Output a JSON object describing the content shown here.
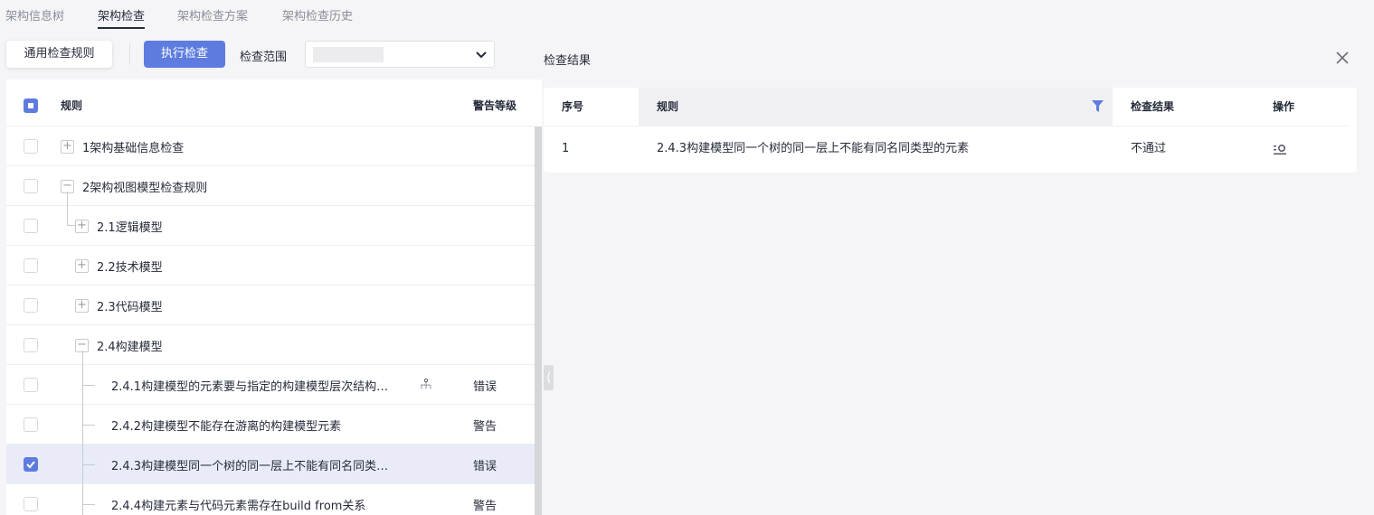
{
  "tabs": [
    "架构信息树",
    "架构检查",
    "架构检查方案",
    "架构检查历史"
  ],
  "toolbar": {
    "general_rules": "通用检查规则",
    "run_check": "执行检查",
    "scope_label": "检查范围",
    "scope_value": ""
  },
  "tree": {
    "header_rule": "规则",
    "header_level": "警告等级",
    "rows": [
      {
        "label": "1架构基础信息检查",
        "level": ""
      },
      {
        "label": "2架构视图模型检查规则",
        "level": ""
      },
      {
        "label": "2.1逻辑模型",
        "level": ""
      },
      {
        "label": "2.2技术模型",
        "level": ""
      },
      {
        "label": "2.3代码模型",
        "level": ""
      },
      {
        "label": "2.4构建模型",
        "level": ""
      },
      {
        "label": "2.4.1构建模型的元素要与指定的构建模型层次结构…",
        "level": "错误"
      },
      {
        "label": "2.4.2构建模型不能存在游离的构建模型元素",
        "level": "警告"
      },
      {
        "label": "2.4.3构建模型同一个树的同一层上不能有同名同类…",
        "level": "错误"
      },
      {
        "label": "2.4.4构建元素与代码元素需存在build from关系",
        "level": "警告"
      }
    ]
  },
  "results": {
    "title": "检查结果",
    "headers": [
      "序号",
      "规则",
      "检查结果",
      "操作"
    ],
    "rows": [
      {
        "index": "1",
        "rule": "2.4.3构建模型同一个树的同一层上不能有同名同类型的元素",
        "result": "不通过"
      }
    ]
  },
  "colors": {
    "accent": "#5e7ce0",
    "selected_row": "#e9ecf8"
  }
}
